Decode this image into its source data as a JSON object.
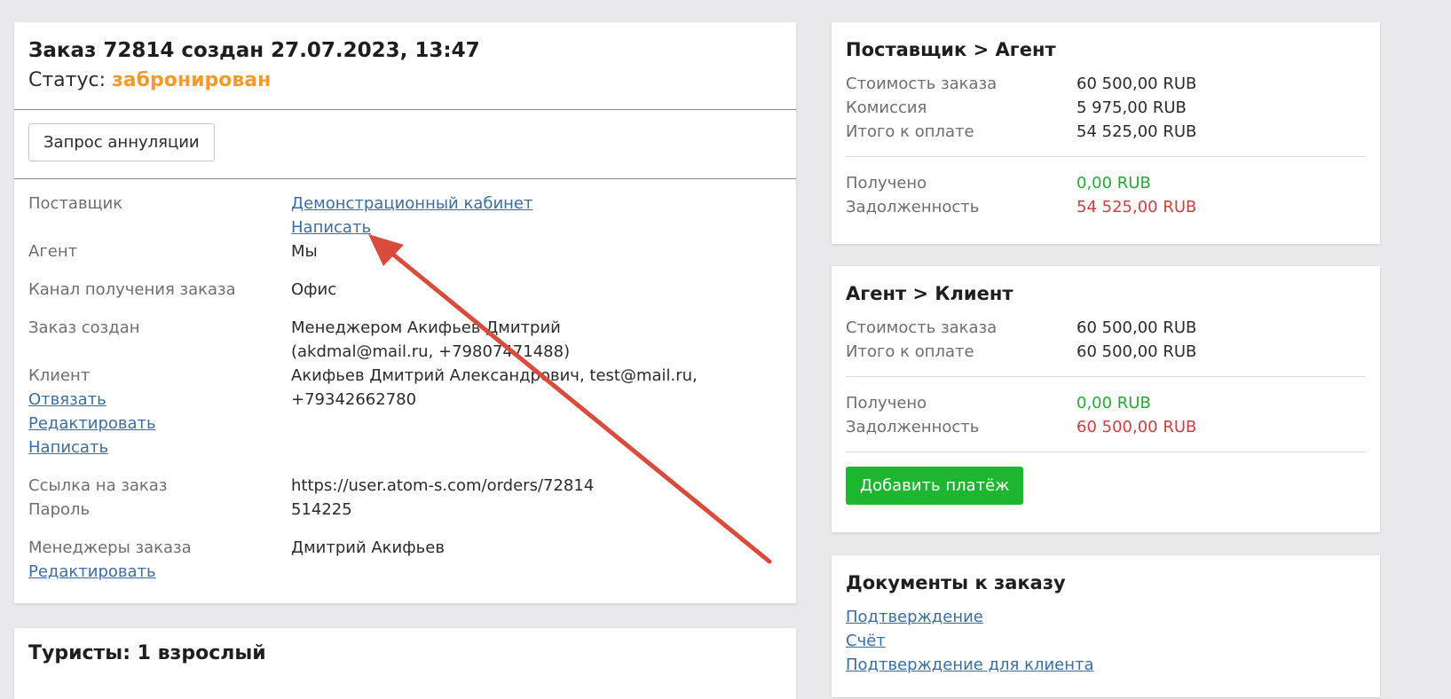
{
  "order": {
    "title": "Заказ 72814 создан 27.07.2023, 13:47",
    "status_label": "Статус:",
    "status_value": "забронирован",
    "cancel_button": "Запрос аннуляции",
    "rows": {
      "supplier_label": "Поставщик",
      "supplier_value": "Демонстрационный кабинет",
      "supplier_write": "Написать",
      "agent_label": "Агент",
      "agent_value": "Мы",
      "channel_label": "Канал получения заказа",
      "channel_value": "Офис",
      "created_label": "Заказ создан",
      "created_value": "Менеджером Акифьев Дмитрий (akdmal@mail.ru, +79807471488)",
      "client_label": "Клиент",
      "client_unlink": "Отвязать",
      "client_edit": "Редактировать",
      "client_write": "Написать",
      "client_value": "Акифьев Дмитрий Александрович, test@mail.ru, +79342662780",
      "link_label": "Ссылка на заказ",
      "link_value": "https://user.atom-s.com/orders/72814",
      "password_label": "Пароль",
      "password_value": "514225",
      "managers_label": "Менеджеры заказа",
      "managers_edit": "Редактировать",
      "managers_value": "Дмитрий Акифьев"
    }
  },
  "tourists": {
    "title": "Туристы: 1 взрослый"
  },
  "supplier_agent": {
    "title": "Поставщик > Агент",
    "cost_label": "Стоимость заказа",
    "cost_value": "60 500,00 RUB",
    "commission_label": "Комиссия",
    "commission_value": "5 975,00 RUB",
    "total_label": "Итого к оплате",
    "total_value": "54 525,00 RUB",
    "received_label": "Получено",
    "received_value": "0,00 RUB",
    "debt_label": "Задолженность",
    "debt_value": "54 525,00 RUB"
  },
  "agent_client": {
    "title": "Агент > Клиент",
    "cost_label": "Стоимость заказа",
    "cost_value": "60 500,00 RUB",
    "total_label": "Итого к оплате",
    "total_value": "60 500,00 RUB",
    "received_label": "Получено",
    "received_value": "0,00 RUB",
    "debt_label": "Задолженность",
    "debt_value": "60 500,00 RUB",
    "add_payment_button": "Добавить платёж"
  },
  "documents": {
    "title": "Документы к заказу",
    "links": [
      "Подтверждение",
      "Счёт",
      "Подтверждение для клиента"
    ]
  },
  "colors": {
    "status": "#f39a2b",
    "received": "#2aa836",
    "debt": "#c94141",
    "button_green": "#1eb530",
    "arrow": "#d94b3c",
    "link": "#3a6ea5"
  }
}
